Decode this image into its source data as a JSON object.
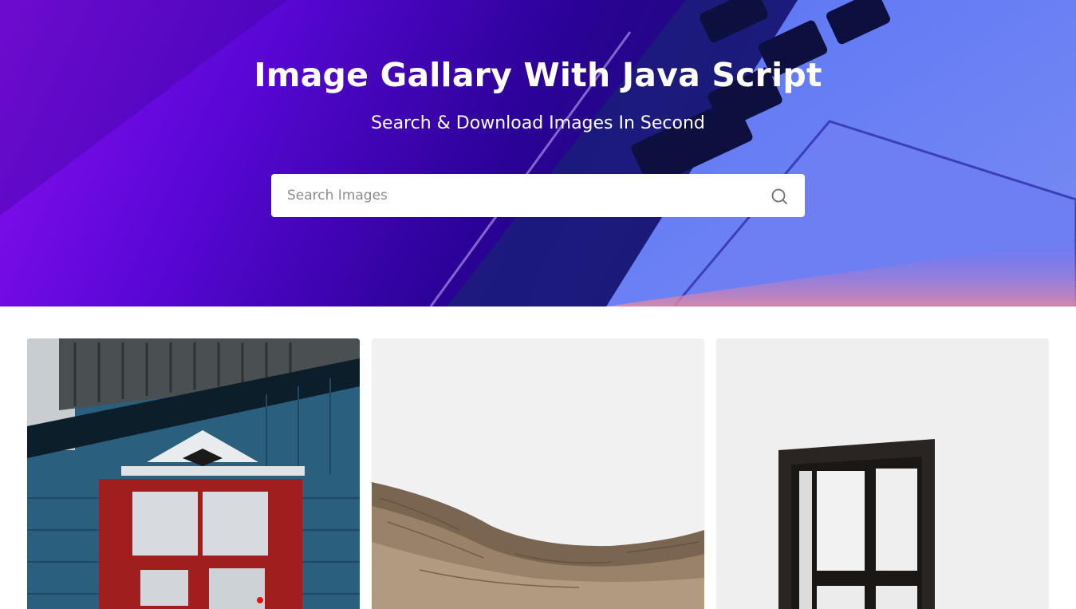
{
  "header": {
    "title": "Image Gallary With Java Script",
    "subtitle": "Search & Download Images In Second"
  },
  "search": {
    "placeholder": "Search Images",
    "value": "",
    "icon": "search-icon"
  },
  "gallery": {
    "images": [
      {
        "subject": "blue wooden house with red door and window"
      },
      {
        "subject": "rocky desert canyon under overcast sky"
      },
      {
        "subject": "dark wooden window frame on white wall"
      }
    ]
  },
  "colors": {
    "hero_left": "#8a0ff0",
    "hero_mid": "#2a0296",
    "hero_right": "#3f5dea",
    "search_bg": "#ffffff",
    "page_bg": "#ffffff"
  }
}
